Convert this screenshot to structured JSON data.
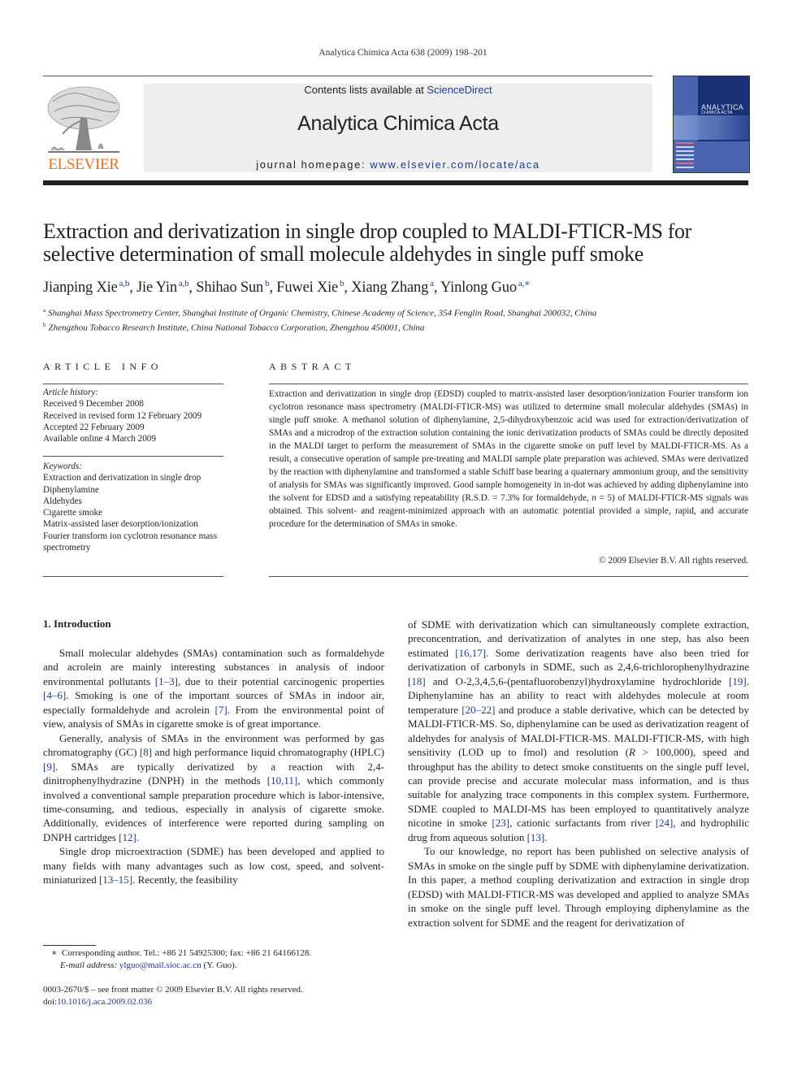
{
  "running_head": "Analytica Chimica Acta 638 (2009) 198–201",
  "masthead": {
    "publisher_logo_text": "ELSEVIER",
    "contents_prefix": "Contents lists available at ",
    "contents_link": "ScienceDirect",
    "journal_name": "Analytica Chimica Acta",
    "homepage_prefix": "journal homepage: ",
    "homepage_link": "www.elsevier.com/locate/aca",
    "cover_title_line1": "ANALYTICA",
    "cover_title_line2": "CHIMICA ACTA",
    "colors": {
      "link": "#1f3c88",
      "publisher_orange": "#e9711c",
      "cover_blue": "#4a64b0"
    }
  },
  "article": {
    "title": "Extraction and derivatization in single drop coupled to MALDI-FTICR-MS for selective determination of small molecule aldehydes in single puff smoke",
    "authors": [
      {
        "name": "Jianping Xie",
        "sup": "a,b",
        "sep": ", "
      },
      {
        "name": "Jie Yin",
        "sup": "a,b",
        "sep": ", "
      },
      {
        "name": "Shihao Sun",
        "sup": "b",
        "sep": ", "
      },
      {
        "name": "Fuwei Xie",
        "sup": "b",
        "sep": ", "
      },
      {
        "name": "Xiang Zhang",
        "sup": "a",
        "sep": ", "
      },
      {
        "name": "Yinlong Guo",
        "sup": "a,∗",
        "sep": ""
      }
    ],
    "affiliations": [
      {
        "mark": "a",
        "text": "Shanghai Mass Spectrometry Center, Shanghai Institute of Organic Chemistry, Chinese Academy of Science, 354 Fenglin Road, Shanghai 200032, China"
      },
      {
        "mark": "b",
        "text": "Zhengzhou Tobacco Research Institute, China National Tobacco Corporation, Zhengzhou 450001, China"
      }
    ]
  },
  "article_info": {
    "heading": "ARTICLE INFO",
    "history_label": "Article history:",
    "history": [
      "Received 9 December 2008",
      "Received in revised form 12 February 2009",
      "Accepted 22 February 2009",
      "Available online 4 March 2009"
    ],
    "keywords_label": "Keywords:",
    "keywords": [
      "Extraction and derivatization in single drop",
      "Diphenylamine",
      "Aldehydes",
      "Cigarette smoke",
      "Matrix-assisted laser desorption/ionization",
      "Fourier transform ion cyclotron resonance mass spectrometry"
    ]
  },
  "abstract": {
    "heading": "ABSTRACT",
    "part1": "Extraction and derivatization in single drop (EDSD) coupled to matrix-assisted laser desorption/ionization Fourier transform ion cyclotron resonance mass spectrometry (MALDI-FTICR-MS) was utilized to determine small molecular aldehydes (SMAs) in single puff smoke. A methanol solution of diphenylamine, 2,5-dihydroxybenzoic acid was used for extraction/derivatization of SMAs and a microdrop of the extraction solution containing the ionic derivatization products of SMAs could be directly deposited in the MALDI target to perform the measurement of SMAs in the cigarette smoke on puff level by MALDI-FTICR-MS. As a result, a consecutive operation of sample pre-treating and MALDI sample plate preparation was achieved. SMAs were derivatized by the reaction with diphenylamine and transformed a stable Schiff base bearing a quaternary ammonium group, and the sensitivity of analysis for SMAs was significantly improved. Good sample homogeneity in in-dot was achieved by adding diphenylamine into the solvent for EDSD and a satisfying repeatability (R.S.D. = 7.3% for formaldehyde, ",
    "italic_n": "n",
    "part2": " = 5) of MALDI-FTICR-MS signals was obtained. This solvent- and reagent-minimized approach with an automatic potential provided a simple, rapid, and accurate procedure for the determination of SMAs in smoke.",
    "copyright": "© 2009 Elsevier B.V. All rights reserved."
  },
  "introduction": {
    "heading": "1.  Introduction",
    "left_paragraphs": [
      [
        {
          "t": "Small molecular aldehydes (SMAs) contamination such as formaldehyde and acrolein are mainly interesting substances in analysis of indoor environmental pollutants "
        },
        {
          "r": "[1–3]"
        },
        {
          "t": ", due to their potential carcinogenic properties "
        },
        {
          "r": "[4–6]"
        },
        {
          "t": ". Smoking is one of the important sources of SMAs in indoor air, especially formaldehyde and acrolein "
        },
        {
          "r": "[7]"
        },
        {
          "t": ". From the environmental point of view, analysis of SMAs in cigarette smoke is of great importance."
        }
      ],
      [
        {
          "t": "Generally, analysis of SMAs in the environment was performed by gas chromatography (GC) "
        },
        {
          "r": "[8]"
        },
        {
          "t": " and high performance liquid chromatography (HPLC) "
        },
        {
          "r": "[9]"
        },
        {
          "t": ". SMAs are typically derivatized by a reaction with 2,4-dinitrophenylhydrazine (DNPH) in the methods "
        },
        {
          "r": "[10,11]"
        },
        {
          "t": ", which commonly involved a conventional sample preparation procedure which is labor-intensive, time-consuming, and tedious, especially in analysis of cigarette smoke. Additionally, evidences of interference were reported during sampling on DNPH cartridges "
        },
        {
          "r": "[12]"
        },
        {
          "t": "."
        }
      ],
      [
        {
          "t": "Single drop microextraction (SDME) has been developed and applied to many fields with many advantages such as low cost, speed, and solvent-miniaturized "
        },
        {
          "r": "[13–15]"
        },
        {
          "t": ". Recently, the feasibility"
        }
      ]
    ],
    "right_paragraphs": [
      [
        {
          "t": "of SDME with derivatization which can simultaneously complete extraction, preconcentration, and derivatization of analytes in one step, has also been estimated "
        },
        {
          "r": "[16,17]"
        },
        {
          "t": ". Some derivatization reagents have also been tried for derivatization of carbonyls in SDME, such as 2,4,6-trichlorophenylhydrazine "
        },
        {
          "r": "[18]"
        },
        {
          "t": " and O-2,3,4,5,6-(pentafluorobenzyl)hydroxylamine hydrochloride "
        },
        {
          "r": "[19]"
        },
        {
          "t": ". Diphenylamine has an ability to react with aldehydes molecule at room temperature "
        },
        {
          "r": "[20–22]"
        },
        {
          "t": " and produce a stable derivative, which can be detected by MALDI-FTICR-MS. So, diphenylamine can be used as derivatization reagent of aldehydes for analysis of MALDI-FTICR-MS. MALDI-FTICR-MS, with high sensitivity (LOD up to fmol) and resolution ("
        },
        {
          "i": "R"
        },
        {
          "t": " > 100,000), speed and throughput has the ability to detect smoke constituents on the single puff level, can provide precise and accurate molecular mass information, and is thus suitable for analyzing trace components in this complex system. Furthermore, SDME coupled to MALDI-MS has been employed to quantitatively analyze nicotine in smoke "
        },
        {
          "r": "[23]"
        },
        {
          "t": ", cationic surfactants from river "
        },
        {
          "r": "[24]"
        },
        {
          "t": ", and hydrophilic drug from aqueous solution "
        },
        {
          "r": "[13]"
        },
        {
          "t": "."
        }
      ],
      [
        {
          "t": "To our knowledge, no report has been published on selective analysis of SMAs in smoke on the single puff by SDME with diphenylamine derivatization. In this paper, a method coupling derivatization and extraction in single drop (EDSD) with MALDI-FTICR-MS was developed and applied to analyze SMAs in smoke on the single puff level. Through employing diphenylamine as the extraction solvent for SDME and the reagent for derivatization of"
        }
      ]
    ]
  },
  "footnote": {
    "mark": "∗",
    "corresponding": "Corresponding author. Tel.: +86 21 54925300; fax: +86 21 64166128.",
    "email_label": "E-mail address: ",
    "email": "ylguo@mail.sioc.ac.cn",
    "email_suffix": " (Y. Guo)."
  },
  "front_matter": {
    "issn_line": "0003-2670/$ – see front matter © 2009 Elsevier B.V. All rights reserved.",
    "doi_prefix": "doi:",
    "doi": "10.1016/j.aca.2009.02.036"
  }
}
